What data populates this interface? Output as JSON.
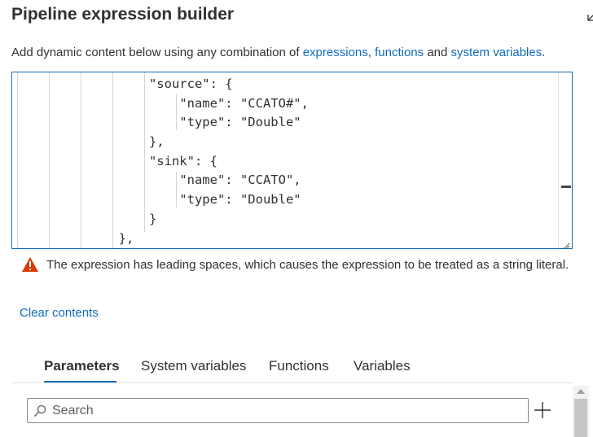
{
  "dialog": {
    "title": "Pipeline expression builder",
    "description_prefix": "Add dynamic content below using any combination of ",
    "link_expressions": "expressions,",
    "link_functions": "functions",
    "description_and": " and ",
    "link_system_variables": "system variables",
    "description_suffix": ".",
    "corner_icon": "collapse-arrow-icon"
  },
  "editor": {
    "lines": [
      "                  \"source\": {",
      "                      \"name\": \"CCATO#\",",
      "                      \"type\": \"Double\"",
      "                  },",
      "                  \"sink\": {",
      "                      \"name\": \"CCATO\",",
      "                      \"type\": \"Double\"",
      "                  }",
      "              },"
    ]
  },
  "warning": {
    "icon": "warning-triangle-icon",
    "color": "#d83b01",
    "text": "The expression has leading spaces, which causes the expression to be treated as a string literal."
  },
  "clear_contents": "Clear contents",
  "tabs": [
    {
      "label": "Parameters",
      "active": true
    },
    {
      "label": "System variables",
      "active": false
    },
    {
      "label": "Functions",
      "active": false
    },
    {
      "label": "Variables",
      "active": false
    }
  ],
  "search": {
    "placeholder": "Search",
    "value": ""
  },
  "accent_color": "#0f6cbd"
}
